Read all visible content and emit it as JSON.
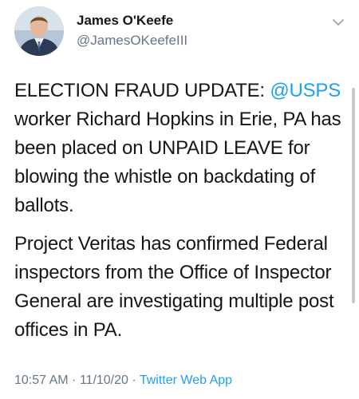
{
  "tweet": {
    "author": {
      "name": "James O'Keefe",
      "handle": "@JamesOKeefeIII"
    },
    "paragraphs": [
      {
        "before": "ELECTION FRAUD UPDATE: ",
        "mention": "@USPS",
        "after": " worker Richard Hopkins in Erie, PA has been placed on UNPAID LEAVE for blowing the whistle on backdating of ballots."
      },
      {
        "text": "Project Veritas has confirmed Federal inspectors from the Office of Inspector General are investigating multiple post offices in PA."
      }
    ],
    "meta": {
      "time": "10:57 AM",
      "separator1": " · ",
      "date": "11/10/20",
      "separator2": " · ",
      "source": "Twitter Web App"
    }
  },
  "icons": {
    "menu": "chevron-down-icon",
    "avatar": "profile-photo"
  },
  "colors": {
    "link": "#1da1f2",
    "text": "#14171a",
    "secondary": "#657786"
  }
}
